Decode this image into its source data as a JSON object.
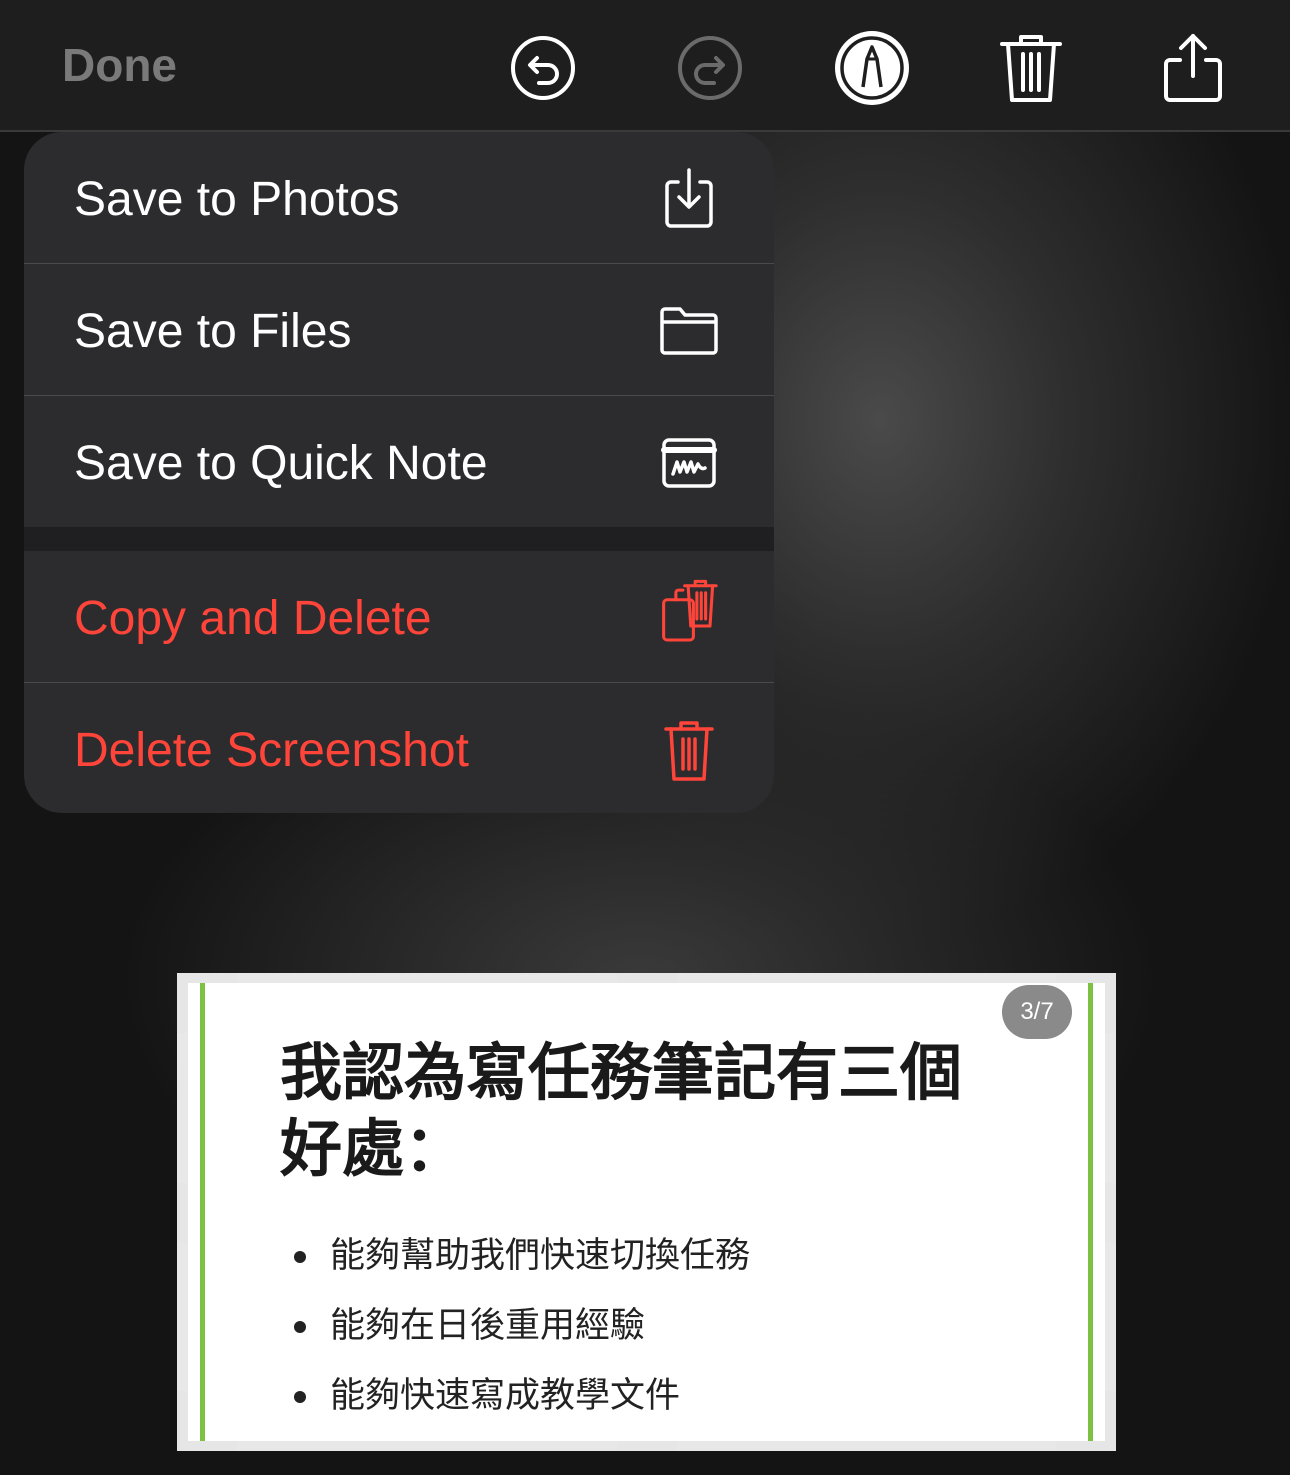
{
  "toolbar": {
    "done_label": "Done",
    "icons": [
      "undo-icon",
      "redo-icon",
      "markup-pen-icon",
      "trash-icon",
      "share-icon"
    ]
  },
  "menu": {
    "items": [
      {
        "label": "Save to Photos",
        "icon": "save-to-photos-icon",
        "destructive": false
      },
      {
        "label": "Save to Files",
        "icon": "folder-icon",
        "destructive": false
      },
      {
        "label": "Save to Quick Note",
        "icon": "quick-note-icon",
        "destructive": false
      },
      {
        "label": "Copy and Delete",
        "icon": "copy-and-delete-icon",
        "destructive": true
      },
      {
        "label": "Delete Screenshot",
        "icon": "trash-icon",
        "destructive": true
      }
    ]
  },
  "thumbnail": {
    "page_badge": "3/7",
    "title": "我認為寫任務筆記有三個好處：",
    "bullets": [
      "能夠幫助我們快速切換任務",
      "能夠在日後重用經驗",
      "能夠快速寫成教學文件"
    ]
  },
  "colors": {
    "destructive": "#ff453a",
    "menu_background": "#2c2c2e",
    "accent_line": "#7cc142"
  }
}
